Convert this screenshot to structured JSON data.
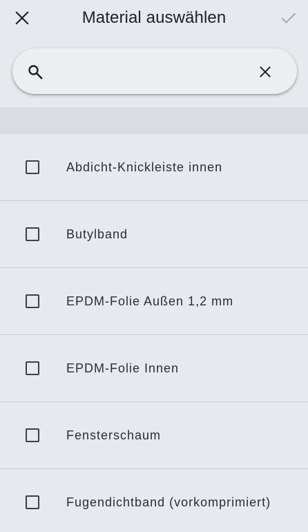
{
  "header": {
    "title": "Material auswählen",
    "close_icon": "close-icon",
    "confirm_icon": "checkmark-icon"
  },
  "search": {
    "value": "",
    "placeholder": "",
    "search_icon": "search-icon",
    "clear_icon": "clear-icon"
  },
  "list": {
    "items": [
      {
        "label": "Abdicht-Knickleiste innen",
        "checked": false
      },
      {
        "label": "Butylband",
        "checked": false
      },
      {
        "label": "EPDM-Folie Außen 1,2 mm",
        "checked": false
      },
      {
        "label": "EPDM-Folie Innen",
        "checked": false
      },
      {
        "label": "Fensterschaum",
        "checked": false
      },
      {
        "label": "Fugendichtband (vorkomprimiert)",
        "checked": false
      }
    ]
  },
  "colors": {
    "background": "#e6e9ed",
    "band": "#d9dde2",
    "divider": "#c8ccd1",
    "text": "#202124",
    "confirm_disabled": "#9aa0a6"
  }
}
